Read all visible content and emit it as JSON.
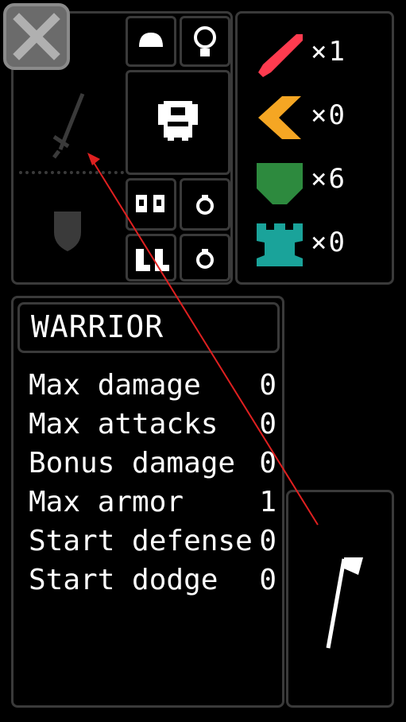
{
  "close_button": {
    "icon": "close-icon"
  },
  "resources": [
    {
      "icon": "sword-icon",
      "color": "#ff3b4f",
      "count": "×1"
    },
    {
      "icon": "chevron-icon",
      "color": "#f5a623",
      "count": "×0"
    },
    {
      "icon": "shield-icon",
      "color": "#2d8a3e",
      "count": "×6"
    },
    {
      "icon": "tower-icon",
      "color": "#1aa39a",
      "count": "×0"
    }
  ],
  "character": {
    "class_name": "WARRIOR",
    "stats": [
      {
        "label": "Max damage",
        "value": "0"
      },
      {
        "label": "Max attacks",
        "value": "0"
      },
      {
        "label": "Bonus damage",
        "value": "0"
      },
      {
        "label": "Max armor",
        "value": "1"
      },
      {
        "label": "Start defense",
        "value": "0"
      },
      {
        "label": "Start dodge",
        "value": "0"
      }
    ]
  },
  "colors": {
    "border": "#3a3a3a",
    "background": "#000000",
    "text": "#ffffff",
    "annotation": "#e02020"
  }
}
